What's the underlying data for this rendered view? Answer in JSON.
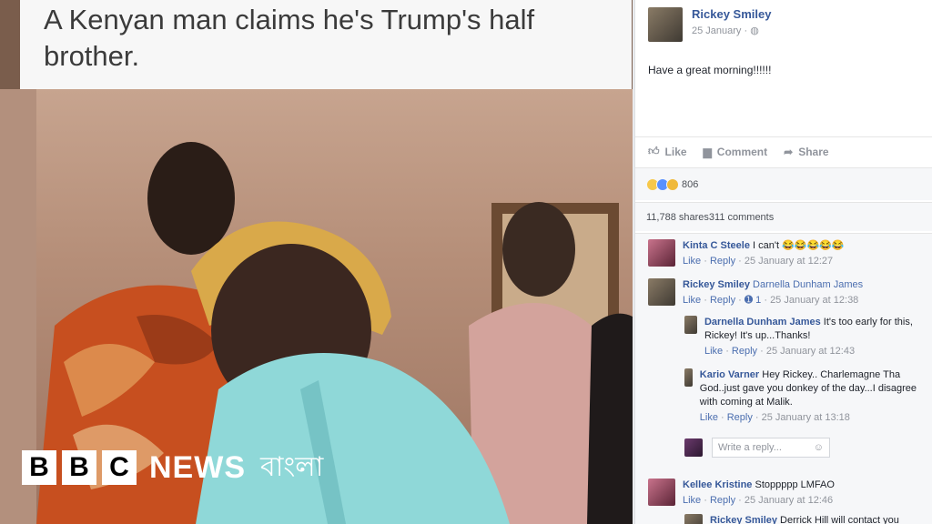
{
  "headline": {
    "line1": "A Kenyan man claims he's Trump's half",
    "line2": "brother."
  },
  "branding": {
    "b1": "B",
    "b2": "B",
    "b3": "C",
    "news": "NEWS",
    "language": "বাংলা"
  },
  "post": {
    "author": "Rickey Smiley",
    "date": "25 January · ",
    "text": "Have a great morning!!!!!!",
    "actions": {
      "like": "Like",
      "comment": "Comment",
      "share": "Share"
    },
    "reaction_count": "806",
    "shares": "11,788 shares",
    "comments_count": "311 comments"
  },
  "comments": [
    {
      "name": "Kinta C Steele",
      "text": " I can't 😂😂😂😂😂",
      "like": "Like",
      "reply": "Reply",
      "time": "25 January at 12:27"
    },
    {
      "name": "Rickey Smiley",
      "text": " Darnella Dunham James",
      "like": "Like",
      "reply": "Reply",
      "replies": "1",
      "time": "25 January at 12:38"
    },
    {
      "name": "Darnella Dunham James",
      "text": " It's too early for this, Rickey! It's up...Thanks!",
      "like": "Like",
      "reply": "Reply",
      "time": "25 January at 12:43"
    },
    {
      "name": "Kario Varner",
      "text": " Hey Rickey.. Charlemagne Tha God..just gave you donkey of the day...I disagree with coming at Malik.",
      "like": "Like",
      "reply": "Reply",
      "time": "25 January at 13:18"
    },
    {
      "name": "Kellee Kristine",
      "text": " Stoppppp LMFAO",
      "like": "Like",
      "reply": "Reply",
      "time": "25 January at 12:46"
    },
    {
      "name": "Rickey Smiley",
      "text": " Derrick Hill will contact you"
    }
  ],
  "reply_box": {
    "placeholder": "Write a reply..."
  },
  "colors": {
    "facebook_link": "#365899",
    "muted": "#90949c",
    "bbc_white": "#ffffff"
  }
}
